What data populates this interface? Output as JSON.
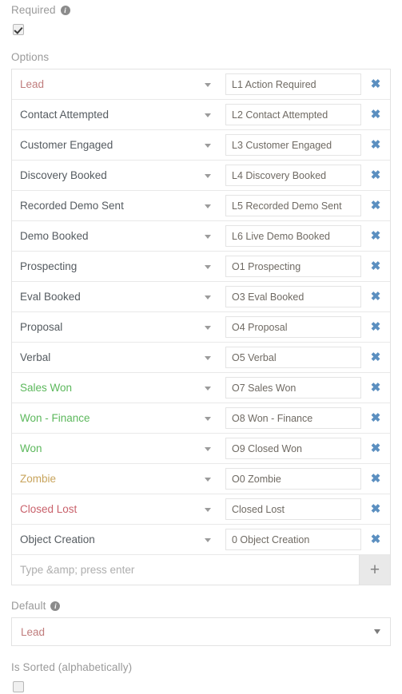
{
  "colors": {
    "label": "#9a9a9a",
    "text": "#555b60",
    "accent_red": "#c07d7d",
    "accent_green": "#5cb85c",
    "accent_orange": "#c8a45c",
    "accent_crimson": "#c9616b",
    "delete_icon": "#5b8fc0",
    "input_text": "#6f6a63",
    "border": "#e2e2e2"
  },
  "required": {
    "label": "Required",
    "info_icon": "info-icon",
    "checked": true,
    "checkbox_name": "required-checkbox"
  },
  "options": {
    "label": "Options",
    "delete_icon": "close-x-icon",
    "dropdown_icon": "chevron-down-icon",
    "rows": [
      {
        "label": "Lead",
        "value": "L1 Action Required",
        "color": "#c07d7d"
      },
      {
        "label": "Contact Attempted",
        "value": "L2 Contact Attempted",
        "color": "#555b60"
      },
      {
        "label": "Customer Engaged",
        "value": "L3 Customer Engaged",
        "color": "#555b60"
      },
      {
        "label": "Discovery Booked",
        "value": "L4 Discovery Booked",
        "color": "#555b60"
      },
      {
        "label": "Recorded Demo Sent",
        "value": "L5 Recorded Demo Sent",
        "color": "#555b60"
      },
      {
        "label": "Demo Booked",
        "value": "L6 Live Demo Booked",
        "color": "#555b60"
      },
      {
        "label": "Prospecting",
        "value": "O1 Prospecting",
        "color": "#555b60"
      },
      {
        "label": "Eval Booked",
        "value": "O3 Eval Booked",
        "color": "#555b60"
      },
      {
        "label": "Proposal",
        "value": "O4 Proposal",
        "color": "#555b60"
      },
      {
        "label": "Verbal",
        "value": "O5 Verbal",
        "color": "#555b60"
      },
      {
        "label": "Sales Won",
        "value": "O7 Sales Won",
        "color": "#5cb85c"
      },
      {
        "label": "Won - Finance",
        "value": "O8 Won - Finance",
        "color": "#5cb85c"
      },
      {
        "label": "Won",
        "value": "O9 Closed Won",
        "color": "#5cb85c"
      },
      {
        "label": "Zombie",
        "value": "O0 Zombie",
        "color": "#c8a45c"
      },
      {
        "label": "Closed Lost",
        "value": "Closed Lost",
        "color": "#c9616b"
      },
      {
        "label": "Object Creation",
        "value": "0 Object Creation",
        "color": "#555b60"
      }
    ],
    "new_option": {
      "placeholder": "Type &amp; press enter",
      "value": "",
      "add_icon": "plus-icon"
    }
  },
  "default": {
    "label": "Default",
    "info_icon": "info-icon",
    "selected": "Lead",
    "selected_color": "#c07d7d",
    "dropdown_icon": "chevron-down-icon"
  },
  "is_sorted": {
    "label": "Is Sorted (alphabetically)",
    "checked": false,
    "checkbox_name": "is-sorted-checkbox"
  }
}
